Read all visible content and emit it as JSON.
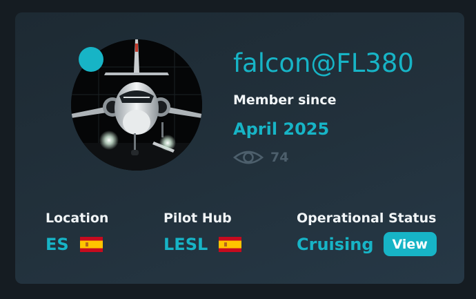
{
  "profile": {
    "username": "falcon@FL380",
    "member_since_label": "Member since",
    "member_since_date": "April 2025",
    "views_icon": "eye-icon",
    "views_count": "74",
    "status_indicator_color": "#17b4c6"
  },
  "stats": [
    {
      "label": "Location",
      "value": "ES",
      "flag": "spain-flag-icon"
    },
    {
      "label": "Pilot Hub",
      "value": "LESL",
      "flag": "spain-flag-icon"
    },
    {
      "label": "Operational Status",
      "value": "Cruising",
      "button_label": "View"
    }
  ],
  "colors": {
    "accent": "#17b4c6",
    "card_background": "#1f2d37",
    "page_background": "#151c22",
    "text_primary": "#f1f5f7",
    "text_muted": "#4d5f6c"
  }
}
